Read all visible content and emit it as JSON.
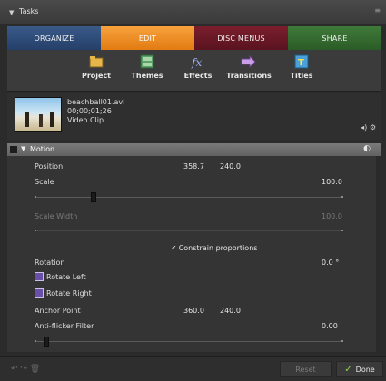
{
  "panel": {
    "title": "Tasks"
  },
  "tabs": [
    {
      "label": "ORGANIZE"
    },
    {
      "label": "EDIT"
    },
    {
      "label": "DISC MENUS"
    },
    {
      "label": "SHARE"
    }
  ],
  "toolbar": [
    {
      "label": "Project",
      "icon": "project-icon"
    },
    {
      "label": "Themes",
      "icon": "themes-icon"
    },
    {
      "label": "Effects",
      "icon": "effects-icon"
    },
    {
      "label": "Transitions",
      "icon": "transitions-icon"
    },
    {
      "label": "Titles",
      "icon": "titles-icon"
    }
  ],
  "clip": {
    "filename": "beachball01.avi",
    "timecode": "00;00;01;26",
    "type": "Video Clip"
  },
  "motion": {
    "section": "Motion",
    "position_label": "Position",
    "position_x": "358.7",
    "position_y": "240.0",
    "scale_label": "Scale",
    "scale_value": "100.0",
    "scale_width_label": "Scale Width",
    "scale_width_value": "100.0",
    "constrain_label": "Constrain proportions",
    "rotation_label": "Rotation",
    "rotation_value": "0.0 °",
    "rotate_left": "Rotate Left",
    "rotate_right": "Rotate Right",
    "anchor_label": "Anchor Point",
    "anchor_x": "360.0",
    "anchor_y": "240.0",
    "antiflicker_label": "Anti-flicker Filter",
    "antiflicker_value": "0.00"
  },
  "footer": {
    "reset": "Reset",
    "done": "Done"
  },
  "colors": {
    "tab_organize": "#2f4e7c",
    "tab_edit": "#ef8f25",
    "tab_disc": "#6b1826",
    "tab_share": "#356c30"
  }
}
